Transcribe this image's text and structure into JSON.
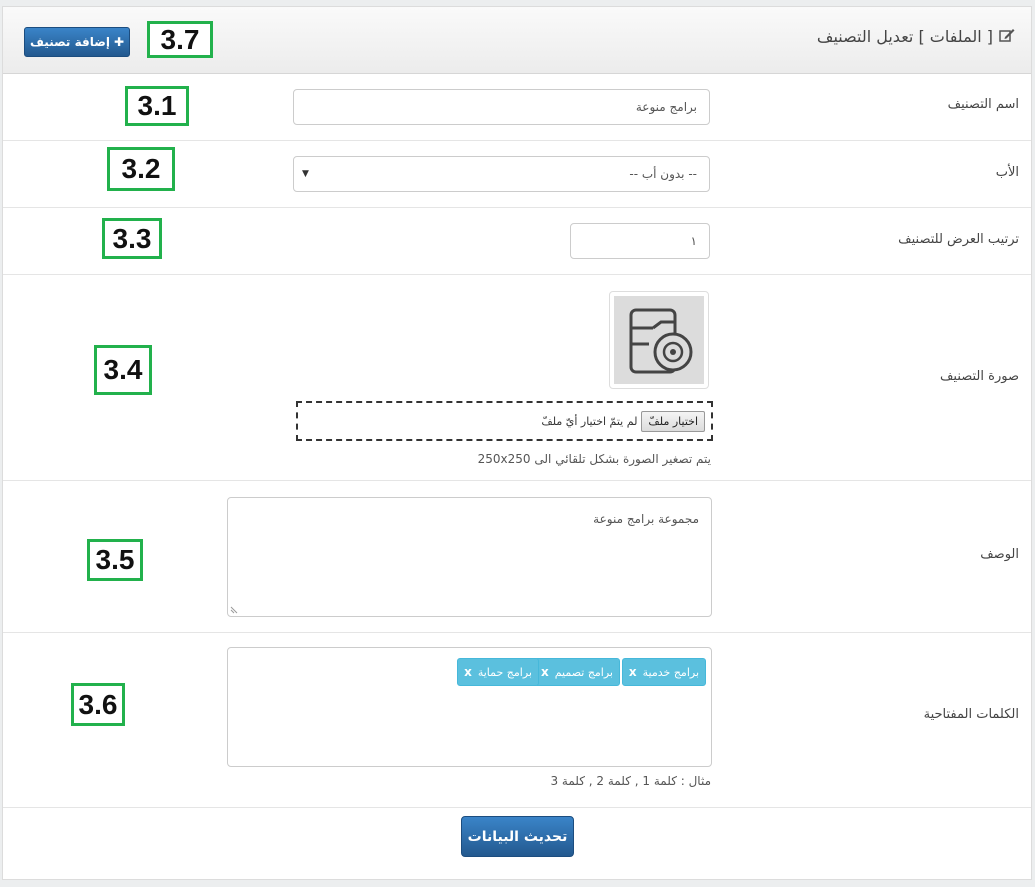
{
  "header": {
    "title": "[ الملفات ] تعديل التصنيف",
    "add_button_label": "إضافة تصنيف",
    "marker": "3.7"
  },
  "fields": {
    "name": {
      "label": "اسم التصنيف",
      "value": "برامج منوعة",
      "marker": "3.1"
    },
    "parent": {
      "label": "الأب",
      "selected": "-- بدون أب --",
      "marker": "3.2"
    },
    "order": {
      "label": "ترتيب العرض للتصنيف",
      "value": "١",
      "marker": "3.3"
    },
    "image": {
      "label": "صورة التصنيف",
      "choose_label": "اختيار ملفّ",
      "no_file": "لم يتمّ اختيار أيّ ملفّ",
      "hint": "يتم تصغير الصورة بشكل تلقائي الى 250x250",
      "marker": "3.4"
    },
    "description": {
      "label": "الوصف",
      "value": "مجموعة برامج منوعة",
      "marker": "3.5"
    },
    "keywords": {
      "label": "الكلمات المفتاحية",
      "tags": [
        "برامج خدمية",
        "برامج تصميم",
        "برامج حماية"
      ],
      "hint": "مثال : كلمة 1 , كلمة 2 , كلمة 3",
      "marker": "3.6"
    }
  },
  "submit_label": "تحديث البيانات",
  "colors": {
    "primary": "#2e6ea9",
    "tag": "#5bc0de",
    "marker_border": "#22b14c"
  }
}
